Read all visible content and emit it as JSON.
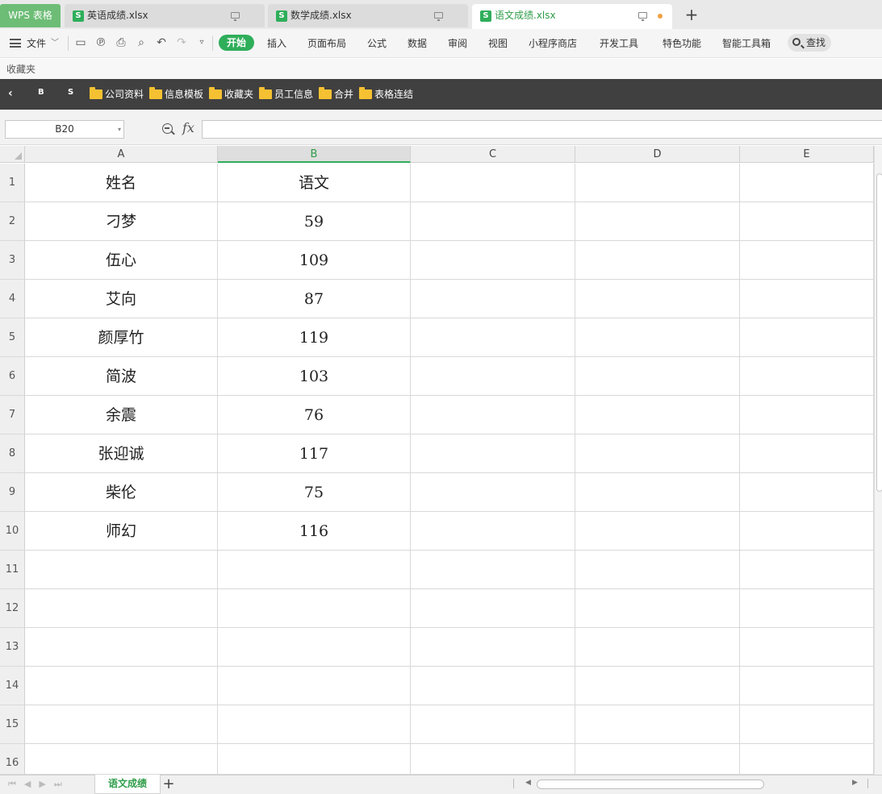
{
  "app": {
    "name": "WPS 表格"
  },
  "tabs": [
    {
      "label": "英语成绩.xlsx",
      "active": false
    },
    {
      "label": "数学成绩.xlsx",
      "active": false
    },
    {
      "label": "语文成绩.xlsx",
      "active": true,
      "unsaved": true
    }
  ],
  "menu": {
    "file_label": "文件",
    "items": [
      "开始",
      "插入",
      "页面布局",
      "公式",
      "数据",
      "审阅",
      "视图",
      "小程序商店",
      "开发工具",
      "特色功能",
      "智能工具箱"
    ],
    "search_label": "查找"
  },
  "favorites_label": "收藏夹",
  "bookmarks": {
    "buttons": [
      "B",
      "S"
    ],
    "folders": [
      "公司资料",
      "信息模板",
      "收藏夹",
      "员工信息",
      "合并",
      "表格连结"
    ]
  },
  "formula_bar": {
    "name_box": "B20",
    "fx_label": "fx",
    "value": ""
  },
  "sheet": {
    "columns": [
      "A",
      "B",
      "C",
      "D",
      "E"
    ],
    "selected_column": "B",
    "row_numbers": [
      "1",
      "2",
      "3",
      "4",
      "5",
      "6",
      "7",
      "8",
      "9",
      "10",
      "11",
      "12",
      "13",
      "14",
      "15",
      "16"
    ],
    "rows": [
      [
        "姓名",
        "语文"
      ],
      [
        "刁梦",
        "59"
      ],
      [
        "伍心",
        "109"
      ],
      [
        "艾向",
        "87"
      ],
      [
        "颜厚竹",
        "119"
      ],
      [
        "简波",
        "103"
      ],
      [
        "余震",
        "76"
      ],
      [
        "张迎诚",
        "117"
      ],
      [
        "柴伦",
        "75"
      ],
      [
        "师幻",
        "116"
      ]
    ]
  },
  "sheet_tabs": [
    {
      "label": "语文成绩",
      "active": true
    }
  ],
  "colors": {
    "accent": "#2fae5a",
    "bookmark_bar": "#404040",
    "folder": "#f5c132"
  }
}
